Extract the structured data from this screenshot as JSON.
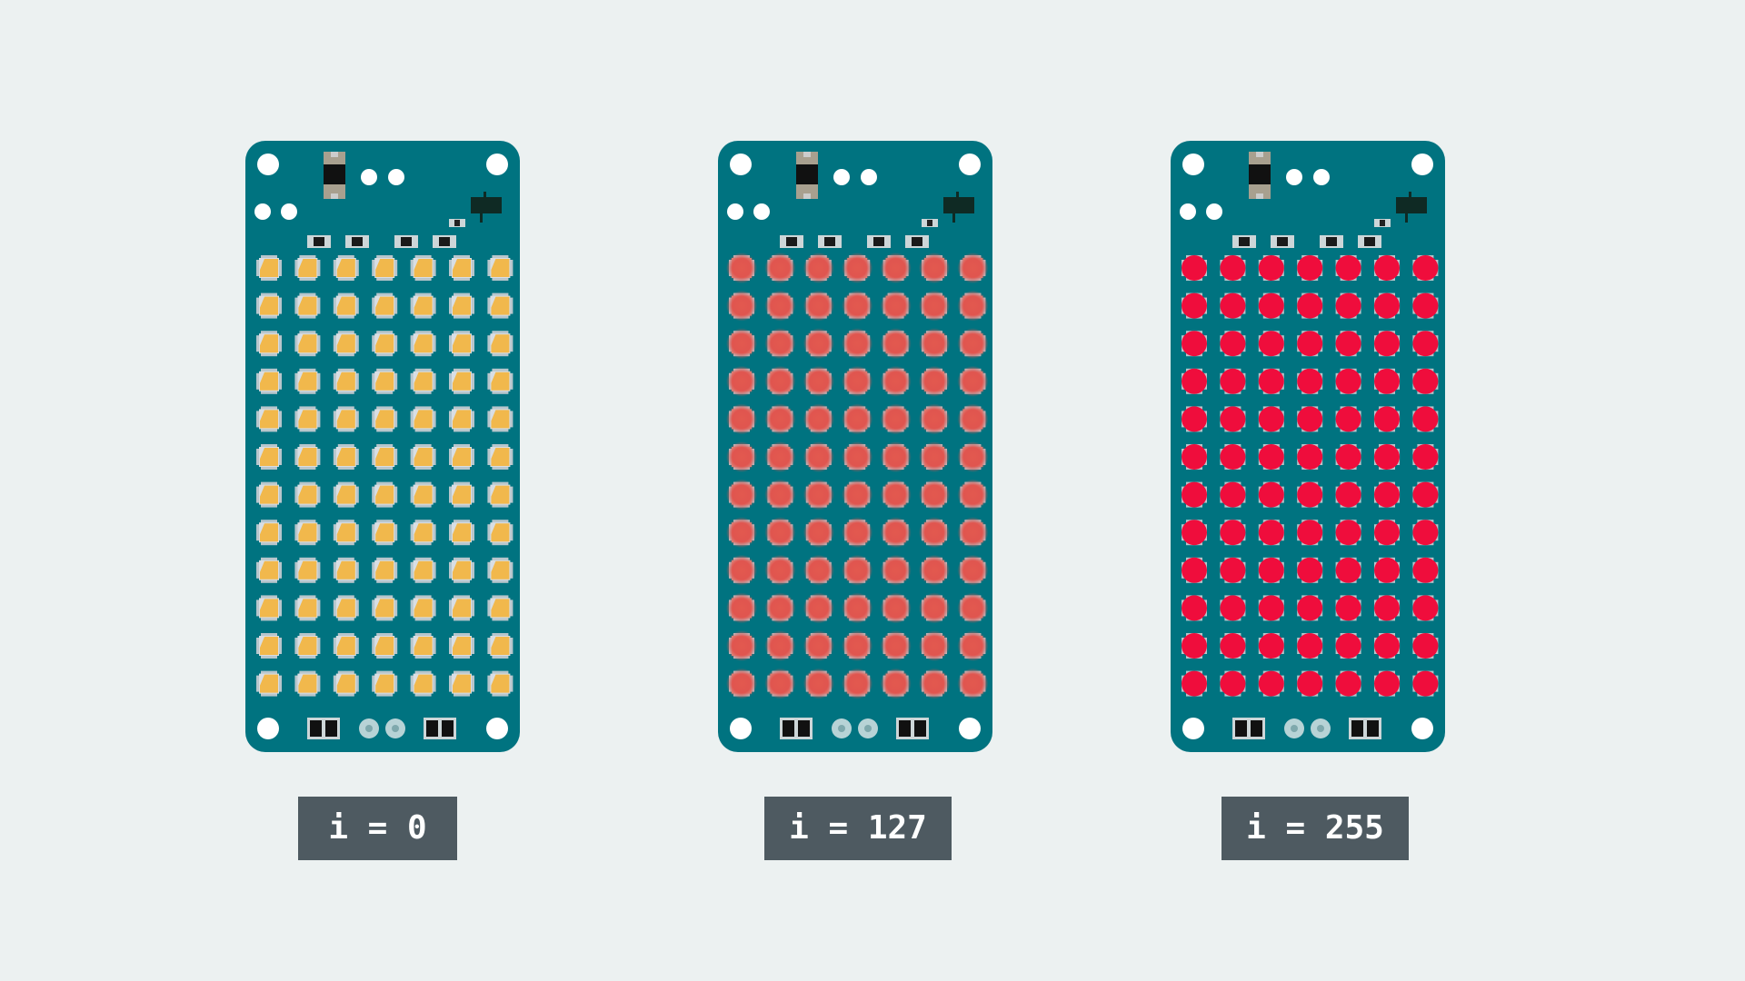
{
  "colors": {
    "background": "#ecf1f1",
    "board": "#007380",
    "hole": "#ffffff",
    "label_bg": "#4e5a61",
    "label_text": "#ffffff",
    "led_off_body": "#d8dee4",
    "led_off_die": "#f1b84c",
    "led_mid": "#e0554f",
    "led_full": "#ef0d3c"
  },
  "matrix": {
    "columns": 7,
    "rows": 12
  },
  "boards": [
    {
      "label": "i = 0",
      "state": "off",
      "brightness": 0
    },
    {
      "label": "i = 127",
      "state": "mid",
      "brightness": 127
    },
    {
      "label": "i = 255",
      "state": "full",
      "brightness": 255
    }
  ]
}
